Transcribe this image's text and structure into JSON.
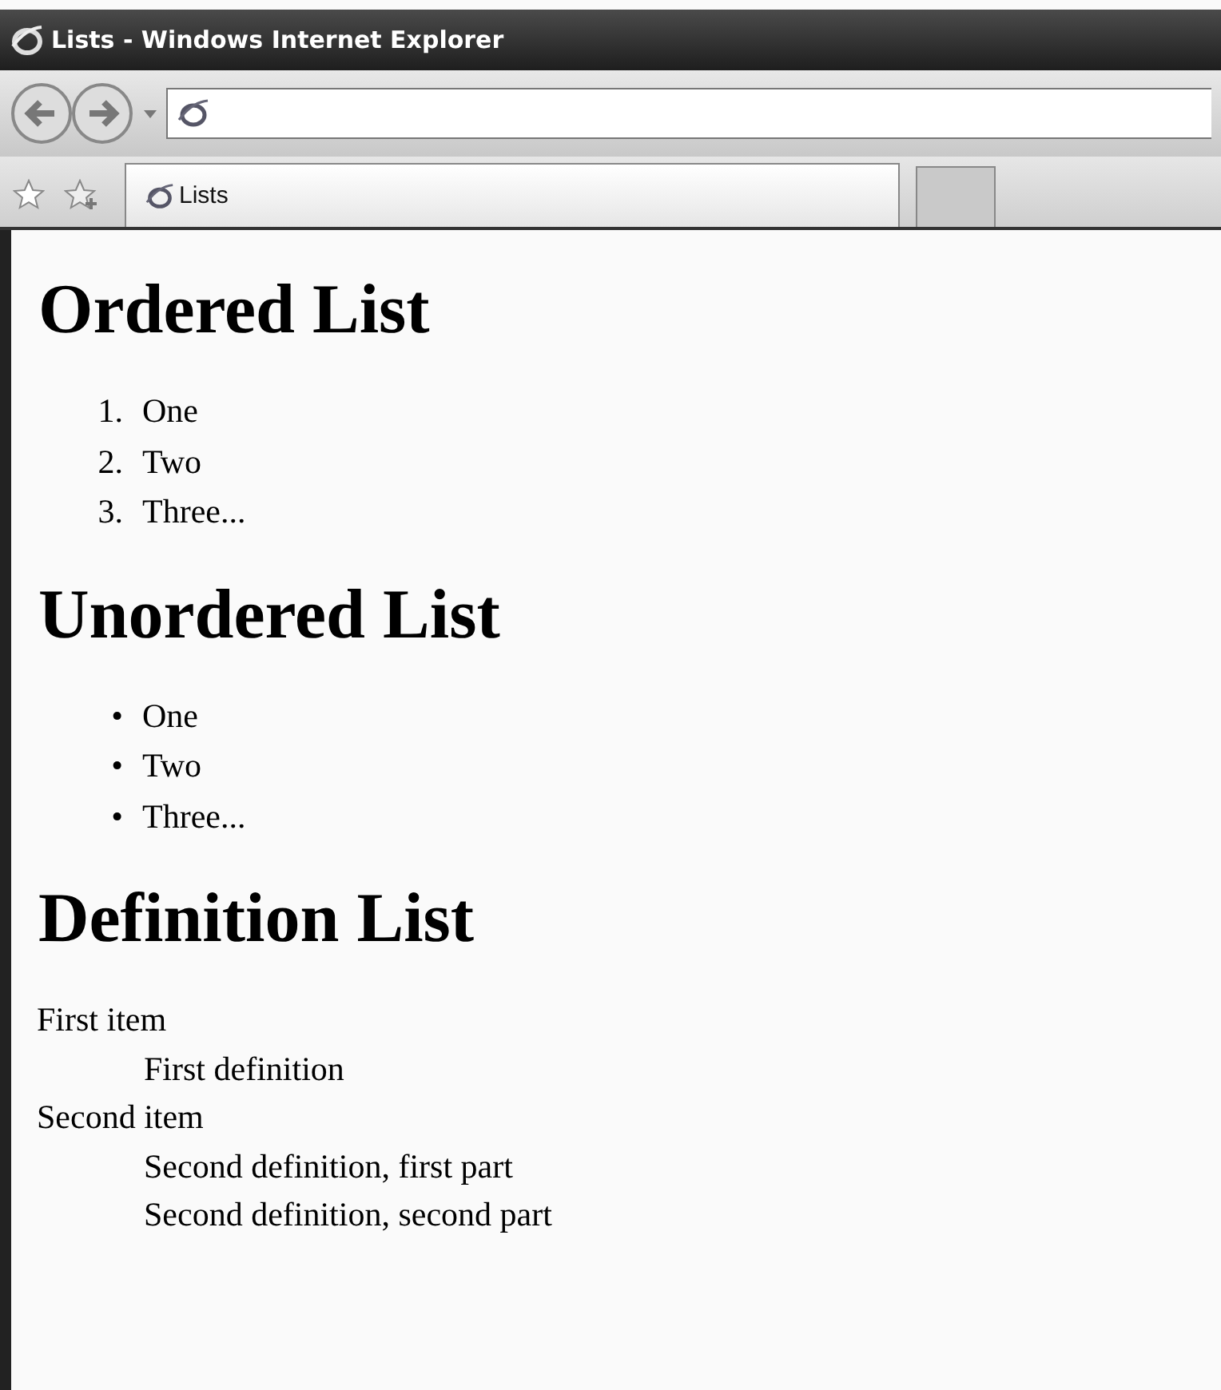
{
  "window": {
    "title": "Lists - Windows Internet Explorer"
  },
  "tab": {
    "label": "Lists"
  },
  "sections": [
    {
      "heading": "Ordered List",
      "kind": "ordered",
      "items": [
        {
          "marker": "1.",
          "text": "One"
        },
        {
          "marker": "2.",
          "text": "Two"
        },
        {
          "marker": "3.",
          "text": "Three..."
        }
      ]
    },
    {
      "heading": "Unordered List",
      "kind": "unordered",
      "items": [
        {
          "marker": "•",
          "text": "One"
        },
        {
          "marker": "•",
          "text": "Two"
        },
        {
          "marker": "•",
          "text": "Three..."
        }
      ]
    },
    {
      "heading": "Definition List",
      "kind": "definition",
      "entries": [
        {
          "term": "First item",
          "definitions": [
            "First definition"
          ]
        },
        {
          "term": "Second item",
          "definitions": [
            "Second definition, first part",
            "Second definition, second part"
          ]
        }
      ]
    }
  ]
}
